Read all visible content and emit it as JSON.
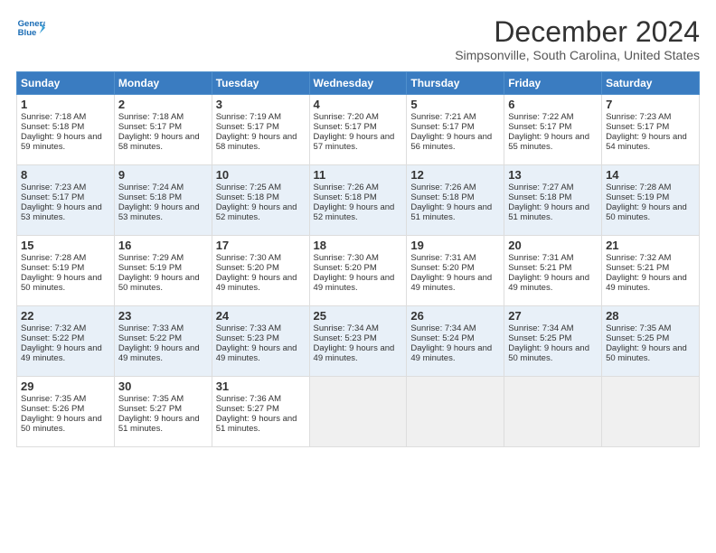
{
  "logo": {
    "line1": "General",
    "line2": "Blue"
  },
  "title": "December 2024",
  "subtitle": "Simpsonville, South Carolina, United States",
  "days_of_week": [
    "Sunday",
    "Monday",
    "Tuesday",
    "Wednesday",
    "Thursday",
    "Friday",
    "Saturday"
  ],
  "weeks": [
    [
      {
        "num": "1",
        "sunrise": "Sunrise: 7:18 AM",
        "sunset": "Sunset: 5:18 PM",
        "daylight": "Daylight: 9 hours and 59 minutes."
      },
      {
        "num": "2",
        "sunrise": "Sunrise: 7:18 AM",
        "sunset": "Sunset: 5:17 PM",
        "daylight": "Daylight: 9 hours and 58 minutes."
      },
      {
        "num": "3",
        "sunrise": "Sunrise: 7:19 AM",
        "sunset": "Sunset: 5:17 PM",
        "daylight": "Daylight: 9 hours and 58 minutes."
      },
      {
        "num": "4",
        "sunrise": "Sunrise: 7:20 AM",
        "sunset": "Sunset: 5:17 PM",
        "daylight": "Daylight: 9 hours and 57 minutes."
      },
      {
        "num": "5",
        "sunrise": "Sunrise: 7:21 AM",
        "sunset": "Sunset: 5:17 PM",
        "daylight": "Daylight: 9 hours and 56 minutes."
      },
      {
        "num": "6",
        "sunrise": "Sunrise: 7:22 AM",
        "sunset": "Sunset: 5:17 PM",
        "daylight": "Daylight: 9 hours and 55 minutes."
      },
      {
        "num": "7",
        "sunrise": "Sunrise: 7:23 AM",
        "sunset": "Sunset: 5:17 PM",
        "daylight": "Daylight: 9 hours and 54 minutes."
      }
    ],
    [
      {
        "num": "8",
        "sunrise": "Sunrise: 7:23 AM",
        "sunset": "Sunset: 5:17 PM",
        "daylight": "Daylight: 9 hours and 53 minutes."
      },
      {
        "num": "9",
        "sunrise": "Sunrise: 7:24 AM",
        "sunset": "Sunset: 5:18 PM",
        "daylight": "Daylight: 9 hours and 53 minutes."
      },
      {
        "num": "10",
        "sunrise": "Sunrise: 7:25 AM",
        "sunset": "Sunset: 5:18 PM",
        "daylight": "Daylight: 9 hours and 52 minutes."
      },
      {
        "num": "11",
        "sunrise": "Sunrise: 7:26 AM",
        "sunset": "Sunset: 5:18 PM",
        "daylight": "Daylight: 9 hours and 52 minutes."
      },
      {
        "num": "12",
        "sunrise": "Sunrise: 7:26 AM",
        "sunset": "Sunset: 5:18 PM",
        "daylight": "Daylight: 9 hours and 51 minutes."
      },
      {
        "num": "13",
        "sunrise": "Sunrise: 7:27 AM",
        "sunset": "Sunset: 5:18 PM",
        "daylight": "Daylight: 9 hours and 51 minutes."
      },
      {
        "num": "14",
        "sunrise": "Sunrise: 7:28 AM",
        "sunset": "Sunset: 5:19 PM",
        "daylight": "Daylight: 9 hours and 50 minutes."
      }
    ],
    [
      {
        "num": "15",
        "sunrise": "Sunrise: 7:28 AM",
        "sunset": "Sunset: 5:19 PM",
        "daylight": "Daylight: 9 hours and 50 minutes."
      },
      {
        "num": "16",
        "sunrise": "Sunrise: 7:29 AM",
        "sunset": "Sunset: 5:19 PM",
        "daylight": "Daylight: 9 hours and 50 minutes."
      },
      {
        "num": "17",
        "sunrise": "Sunrise: 7:30 AM",
        "sunset": "Sunset: 5:20 PM",
        "daylight": "Daylight: 9 hours and 49 minutes."
      },
      {
        "num": "18",
        "sunrise": "Sunrise: 7:30 AM",
        "sunset": "Sunset: 5:20 PM",
        "daylight": "Daylight: 9 hours and 49 minutes."
      },
      {
        "num": "19",
        "sunrise": "Sunrise: 7:31 AM",
        "sunset": "Sunset: 5:20 PM",
        "daylight": "Daylight: 9 hours and 49 minutes."
      },
      {
        "num": "20",
        "sunrise": "Sunrise: 7:31 AM",
        "sunset": "Sunset: 5:21 PM",
        "daylight": "Daylight: 9 hours and 49 minutes."
      },
      {
        "num": "21",
        "sunrise": "Sunrise: 7:32 AM",
        "sunset": "Sunset: 5:21 PM",
        "daylight": "Daylight: 9 hours and 49 minutes."
      }
    ],
    [
      {
        "num": "22",
        "sunrise": "Sunrise: 7:32 AM",
        "sunset": "Sunset: 5:22 PM",
        "daylight": "Daylight: 9 hours and 49 minutes."
      },
      {
        "num": "23",
        "sunrise": "Sunrise: 7:33 AM",
        "sunset": "Sunset: 5:22 PM",
        "daylight": "Daylight: 9 hours and 49 minutes."
      },
      {
        "num": "24",
        "sunrise": "Sunrise: 7:33 AM",
        "sunset": "Sunset: 5:23 PM",
        "daylight": "Daylight: 9 hours and 49 minutes."
      },
      {
        "num": "25",
        "sunrise": "Sunrise: 7:34 AM",
        "sunset": "Sunset: 5:23 PM",
        "daylight": "Daylight: 9 hours and 49 minutes."
      },
      {
        "num": "26",
        "sunrise": "Sunrise: 7:34 AM",
        "sunset": "Sunset: 5:24 PM",
        "daylight": "Daylight: 9 hours and 49 minutes."
      },
      {
        "num": "27",
        "sunrise": "Sunrise: 7:34 AM",
        "sunset": "Sunset: 5:25 PM",
        "daylight": "Daylight: 9 hours and 50 minutes."
      },
      {
        "num": "28",
        "sunrise": "Sunrise: 7:35 AM",
        "sunset": "Sunset: 5:25 PM",
        "daylight": "Daylight: 9 hours and 50 minutes."
      }
    ],
    [
      {
        "num": "29",
        "sunrise": "Sunrise: 7:35 AM",
        "sunset": "Sunset: 5:26 PM",
        "daylight": "Daylight: 9 hours and 50 minutes."
      },
      {
        "num": "30",
        "sunrise": "Sunrise: 7:35 AM",
        "sunset": "Sunset: 5:27 PM",
        "daylight": "Daylight: 9 hours and 51 minutes."
      },
      {
        "num": "31",
        "sunrise": "Sunrise: 7:36 AM",
        "sunset": "Sunset: 5:27 PM",
        "daylight": "Daylight: 9 hours and 51 minutes."
      },
      null,
      null,
      null,
      null
    ]
  ]
}
